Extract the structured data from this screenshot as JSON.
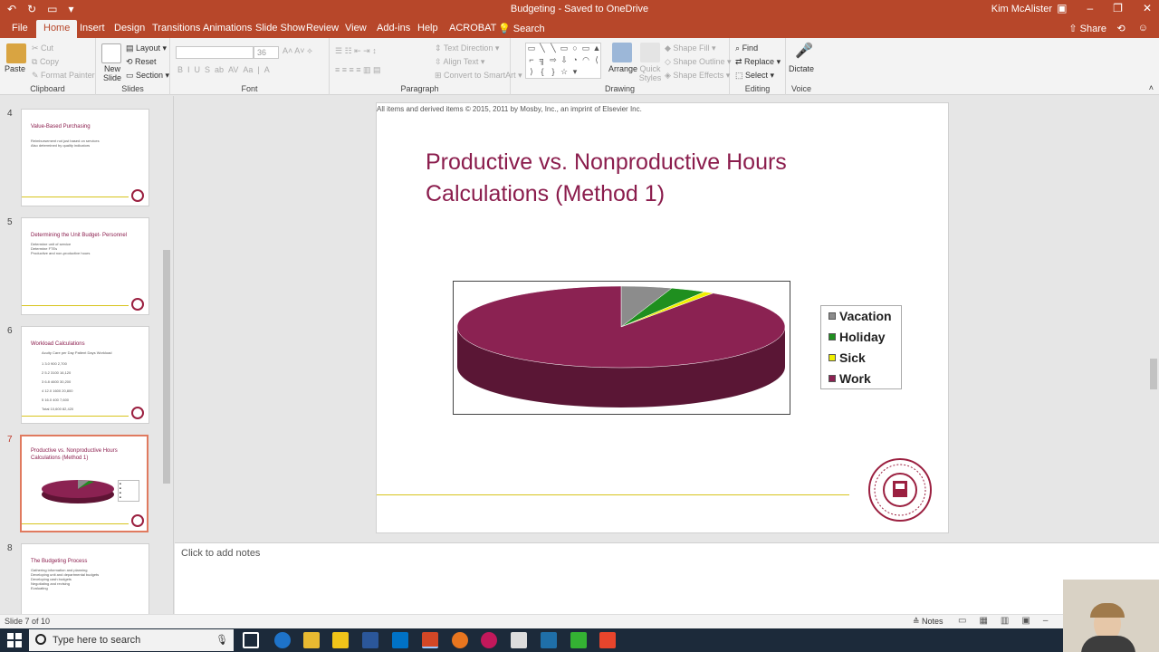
{
  "titlebar": {
    "doc_title": "Budgeting  -  Saved to OneDrive",
    "user": "Kim McAlister",
    "autosave_icon": "undo-icon"
  },
  "tabs": [
    "File",
    "Home",
    "Insert",
    "Design",
    "Transitions",
    "Animations",
    "Slide Show",
    "Review",
    "View",
    "Add-ins",
    "Help",
    "ACROBAT"
  ],
  "tell_me": "Search",
  "share_label": "Share",
  "ribbon": {
    "clipboard": {
      "paste": "Paste",
      "cut": "Cut",
      "copy": "Copy",
      "format_painter": "Format Painter",
      "label": "Clipboard"
    },
    "slides": {
      "new_slide": "New Slide",
      "layout": "Layout",
      "reset": "Reset",
      "section": "Section",
      "label": "Slides"
    },
    "font": {
      "size": "36",
      "label": "Font"
    },
    "paragraph": {
      "text_direction": "Text Direction",
      "align_text": "Align Text",
      "convert": "Convert to SmartArt",
      "label": "Paragraph"
    },
    "drawing": {
      "arrange": "Arrange",
      "quick_styles": "Quick Styles",
      "shape_fill": "Shape Fill",
      "shape_outline": "Shape Outline",
      "shape_effects": "Shape Effects",
      "label": "Drawing"
    },
    "editing": {
      "find": "Find",
      "replace": "Replace",
      "select": "Select",
      "label": "Editing"
    },
    "voice": {
      "dictate": "Dictate",
      "label": "Voice"
    }
  },
  "thumbnails": [
    {
      "num": "4",
      "title": "Value-Based Purchasing",
      "lines": [
        "Reimbursement not just based on services",
        "Also determined by quality indicators"
      ]
    },
    {
      "num": "5",
      "title": "Determining the Unit Budget- Personnel",
      "lines": [
        "Determine unit of service",
        "Determine FTEs",
        "Productive and non-productive hours"
      ]
    },
    {
      "num": "6",
      "title": "Workload Calculations",
      "lines": [
        "Acuity  Care per Day  Patient Days  Workload",
        "1   3.0   900   2,700",
        "2   5.2   3100   16,120",
        "3   6.8   4600   30,200",
        "4   12.0   1600   20,800",
        "5   16.0   400   7,600",
        "Total   10,600   82,420"
      ]
    },
    {
      "num": "7",
      "title": "Productive vs. Nonproductive Hours Calculations (Method 1)",
      "lines": []
    },
    {
      "num": "8",
      "title": "The Budgeting Process",
      "lines": [
        "Gathering information and planning",
        "Developing unit and departmental budgets",
        "Developing cash budgets",
        "Negotiating and revising",
        "Evaluating"
      ]
    }
  ],
  "slide": {
    "copyright": "All items and derived items © 2015, 2011 by Mosby, Inc., an imprint of Elsevier Inc.",
    "title": "Productive vs. Nonproductive Hours Calculations (Method 1)"
  },
  "chart_data": {
    "type": "pie",
    "labels": [
      "Vacation",
      "Holiday",
      "Sick",
      "Work"
    ],
    "values": [
      5,
      3.5,
      1,
      90.5
    ],
    "colors": [
      "#8c8c8c",
      "#1f8f1f",
      "#f0f000",
      "#8b2252"
    ],
    "legend_position": "right"
  },
  "notes_placeholder": "Click to add notes",
  "status": {
    "slide_of": "Slide 7 of 10",
    "notes_label": "Notes"
  },
  "taskbar": {
    "search_placeholder": "Type here to search"
  }
}
